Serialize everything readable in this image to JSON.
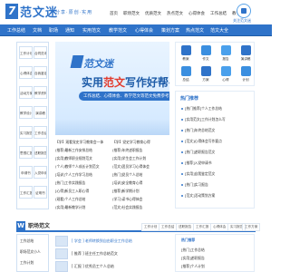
{
  "header": {
    "logo_text": "范文迷",
    "logo_mark": "7",
    "logo_slogan": "分享·原创·实用",
    "nav": [
      "首页",
      "职场范文",
      "优质范文",
      "热点范文",
      "心得体会",
      "工作总结",
      "教学范文"
    ],
    "qr_label": "关注范文迷"
  },
  "catnav": [
    "工作总结",
    "文档",
    "职场",
    "通知",
    "实用范文",
    "教学范文",
    "心得体会",
    "策划方案",
    "热点范文",
    "范文大全"
  ],
  "left_menu": [
    "工作计划",
    "合同范本",
    "心得体会",
    "自我鉴定",
    "活动方案",
    "教学资料",
    "教学设计",
    "演讲稿",
    "实习报告",
    "工作总结",
    "思想汇报",
    "述职报告",
    "申请书",
    "入党申请",
    "工作汇报",
    "证明书"
  ],
  "banner": {
    "brand": "范文迷",
    "title_pre": "实用",
    "title_hl": "范文",
    "title_post": "写作好帮手",
    "tag": "工作总结、心得体会、教学范文等范文免费参考"
  },
  "icons": [
    {
      "icon": "doc-icon",
      "label": "教案"
    },
    {
      "icon": "book-icon",
      "label": "作文"
    },
    {
      "icon": "chart-icon",
      "label": "报告"
    },
    {
      "icon": "pen-icon",
      "label": "演讲稿"
    },
    {
      "icon": "list-icon",
      "label": "总结"
    },
    {
      "icon": "star-icon",
      "label": "方案"
    },
    {
      "icon": "cup-icon",
      "label": "心得"
    },
    {
      "icon": "note-icon",
      "label": "计划"
    }
  ],
  "hot": {
    "title": "热门推荐",
    "items": [
      "[热门推荐]个人工作总结",
      "[实用范文]工作计划怎么写",
      "[热门]年终总结范文",
      "[范文]心得体会写作要点",
      "[热门]述职报告范文",
      "[推荐]入党申请书",
      "[实用]自我鉴定范文",
      "[热门]实习报告",
      "[范文]活动策划方案"
    ]
  },
  "news_left": [
    "【学】观看党史学习教育会一体",
    "(推荐)最新工作安排总结",
    "[实用]教师职业规划范文",
    "(个人)教师个人成长计划范文",
    "[培训]个人工作学习总结",
    "[热门]工作实践报告",
    "[心得]新员工入职心得",
    "(观看)个人工作总结",
    "(实用)最新教学计划"
  ],
  "news_right": [
    "【学】党史学习教育心得",
    "(推荐)年终述职报告",
    "[实用]学生会工作计划",
    "(范文)团员学习心得体会",
    "[热门]党员个人总结",
    "[培训]安全教育心得",
    "[推荐]新学期计划",
    "(学习)读书心得体会",
    "(范文)社会实践报告"
  ],
  "section": {
    "w": "W",
    "title": "职场范文",
    "tabs": [
      "工作计划",
      "工作总结",
      "述职报告",
      "工作汇报",
      "心得体会",
      "实习报告",
      "工作方案"
    ]
  },
  "bottom_left": [
    "工作总结",
    "职场范文小人",
    "工作计划"
  ],
  "bottom_mid": [
    "[ 学会 ] 老师转换到自由职业工作总结",
    "[ 推荐 ] 班主任工作总结范文",
    "[ 汇报 ] 优秀员工个人总结"
  ],
  "bottom_right": {
    "title": "热门推荐",
    "items": [
      "[热门]工作总结",
      "[实用]述职报告",
      "[推荐]个人计划"
    ]
  }
}
